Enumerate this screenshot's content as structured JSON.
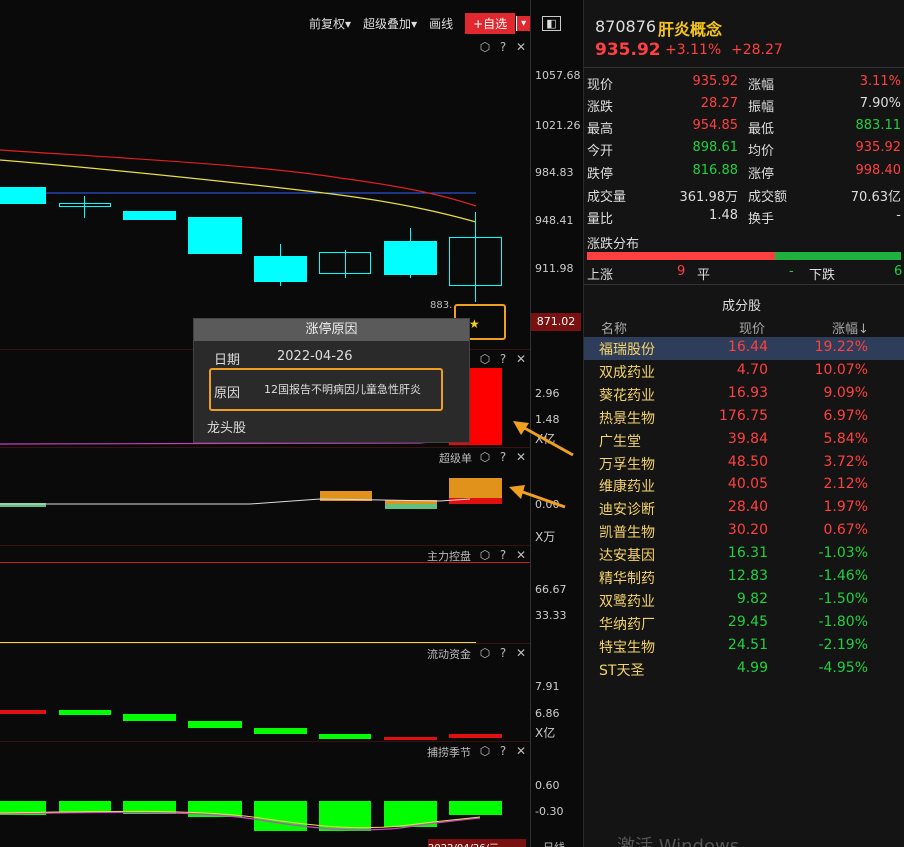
{
  "toolbar": {
    "adjust": "前复权",
    "overlay": "超级叠加",
    "draw": "画线",
    "add_watch": "+自选",
    "dropdown_glyph": "▾",
    "layout_glyph": "◧"
  },
  "main_chart": {
    "yticks": [
      "1057.68",
      "1021.26",
      "984.83",
      "948.41",
      "911.98"
    ],
    "low_label": "883.",
    "current_price_tag": "871.02"
  },
  "popup": {
    "title": "涨停原因",
    "date_label": "日期",
    "date_value": "2022-04-26",
    "reason_label": "原因",
    "reason_value": "12国报告不明病因儿童急性肝炎",
    "leader_label": "龙头股"
  },
  "panels": {
    "volume": {
      "yticks": [
        "2.96",
        "1.48"
      ],
      "unit": "X亿"
    },
    "super_order": {
      "label": "超级单",
      "ytick": "0.00",
      "unit": "X万"
    },
    "main_control": {
      "label": "主力控盘",
      "yticks": [
        "66.67",
        "33.33"
      ]
    },
    "liquidity": {
      "label": "流动资金",
      "yticks": [
        "7.91",
        "6.86"
      ],
      "unit": "X亿"
    },
    "season": {
      "label": "捕捞季节",
      "yticks": [
        "0.60",
        "-0.30"
      ]
    }
  },
  "bottom": {
    "date": "2022/04/26/二",
    "tab": "日线",
    "watermark": "激活 Windows"
  },
  "quote": {
    "code": "870876",
    "name": "肝炎概念",
    "price": "935.92",
    "change_pct": "+3.11%",
    "change": "+28.27",
    "rows": [
      {
        "k1": "现价",
        "v1": "935.92",
        "c1": "red",
        "k2": "涨幅",
        "v2": "3.11%",
        "c2": "red"
      },
      {
        "k1": "涨跌",
        "v1": "28.27",
        "c1": "red",
        "k2": "振幅",
        "v2": "7.90%",
        "c2": "white"
      },
      {
        "k1": "最高",
        "v1": "954.85",
        "c1": "red",
        "k2": "最低",
        "v2": "883.11",
        "c2": "green"
      },
      {
        "k1": "今开",
        "v1": "898.61",
        "c1": "green",
        "k2": "均价",
        "v2": "935.92",
        "c2": "red"
      },
      {
        "k1": "跌停",
        "v1": "816.88",
        "c1": "green",
        "k2": "涨停",
        "v2": "998.40",
        "c2": "red"
      },
      {
        "k1": "成交量",
        "v1": "361.98万",
        "c1": "white",
        "k2": "成交额",
        "v2": "70.63亿",
        "c2": "white"
      },
      {
        "k1": "量比",
        "v1": "1.48",
        "c1": "white",
        "k2": "换手",
        "v2": "-",
        "c2": "white"
      }
    ],
    "dist_title": "涨跌分布",
    "dist": {
      "up_label": "上涨",
      "up": "9",
      "flat_label": "平",
      "flat": "-",
      "down_label": "下跌",
      "down": "6",
      "up_fraction": 0.6
    }
  },
  "components": {
    "title": "成分股",
    "headers": {
      "name": "名称",
      "price": "现价",
      "chg": "涨幅↓"
    },
    "rows": [
      {
        "name": "福瑞股份",
        "price": "16.44",
        "chg": "19.22%",
        "dir": "up"
      },
      {
        "name": "双成药业",
        "price": "4.70",
        "chg": "10.07%",
        "dir": "up"
      },
      {
        "name": "葵花药业",
        "price": "16.93",
        "chg": "9.09%",
        "dir": "up"
      },
      {
        "name": "热景生物",
        "price": "176.75",
        "chg": "6.97%",
        "dir": "up"
      },
      {
        "name": "广生堂",
        "price": "39.84",
        "chg": "5.84%",
        "dir": "up"
      },
      {
        "name": "万孚生物",
        "price": "48.50",
        "chg": "3.72%",
        "dir": "up"
      },
      {
        "name": "维康药业",
        "price": "40.05",
        "chg": "2.12%",
        "dir": "up"
      },
      {
        "name": "迪安诊断",
        "price": "28.40",
        "chg": "1.97%",
        "dir": "up"
      },
      {
        "name": "凯普生物",
        "price": "30.20",
        "chg": "0.67%",
        "dir": "up"
      },
      {
        "name": "达安基因",
        "price": "16.31",
        "chg": "-1.03%",
        "dir": "down"
      },
      {
        "name": "精华制药",
        "price": "12.83",
        "chg": "-1.46%",
        "dir": "down"
      },
      {
        "name": "双鹭药业",
        "price": "9.82",
        "chg": "-1.50%",
        "dir": "down"
      },
      {
        "name": "华纳药厂",
        "price": "29.45",
        "chg": "-1.80%",
        "dir": "down"
      },
      {
        "name": "特宝生物",
        "price": "24.51",
        "chg": "-2.19%",
        "dir": "down"
      },
      {
        "name": "ST天圣",
        "price": "4.99",
        "chg": "-4.95%",
        "dir": "down"
      }
    ]
  },
  "colors": {
    "up": "#ff4040",
    "down": "#20d040",
    "highlight": "#f0a020",
    "candle": "#00ffff"
  }
}
